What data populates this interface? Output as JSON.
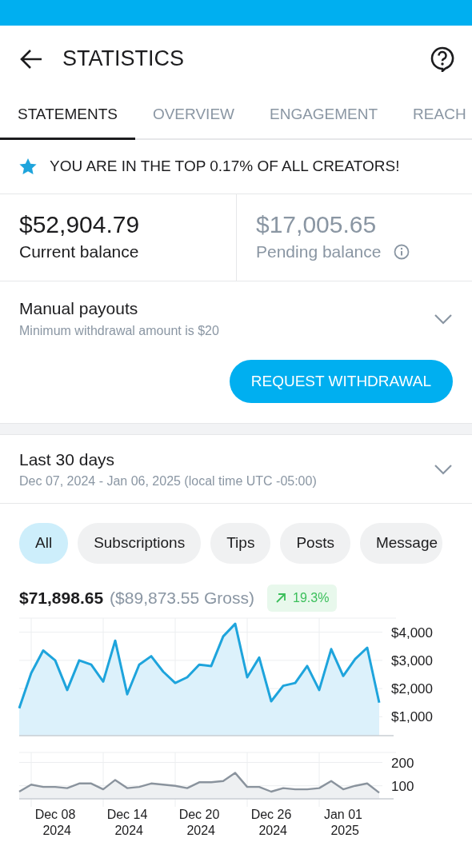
{
  "header": {
    "title": "STATISTICS"
  },
  "tabs": [
    {
      "label": "STATEMENTS",
      "selected": true
    },
    {
      "label": "OVERVIEW",
      "selected": false
    },
    {
      "label": "ENGAGEMENT",
      "selected": false
    },
    {
      "label": "REACH",
      "selected": false
    }
  ],
  "banner": {
    "text": "YOU ARE IN THE TOP 0.17% OF ALL CREATORS!"
  },
  "balances": [
    {
      "kind": "current",
      "amount": "$52,904.79",
      "label": "Current balance"
    },
    {
      "kind": "pending",
      "amount": "$17,005.65",
      "label": "Pending balance"
    }
  ],
  "payouts": {
    "title": "Manual payouts",
    "note": "Minimum withdrawal amount is $20",
    "expanded": false,
    "button": "REQUEST WITHDRAWAL"
  },
  "period": {
    "title": "Last 30 days",
    "range": "Dec 07, 2024 - Jan 06, 2025 (local time UTC -05:00)",
    "expanded": false
  },
  "filters": [
    {
      "label": "All",
      "selected": true
    },
    {
      "label": "Subscriptions",
      "selected": false
    },
    {
      "label": "Tips",
      "selected": false
    },
    {
      "label": "Posts",
      "selected": false
    },
    {
      "label": "Message",
      "selected": false
    }
  ],
  "summary": {
    "net": "$71,898.65",
    "gross": "($89,873.55 Gross)",
    "change": "19.3%",
    "rising": true
  },
  "earnings_chart": {
    "chart_data": {
      "type": "area",
      "grid": true,
      "ylim": [
        330,
        4500
      ],
      "yticks": [
        {
          "value": 1000,
          "label": "$1,000"
        },
        {
          "value": 2000,
          "label": "$2,000"
        },
        {
          "value": 3000,
          "label": "$3,000"
        },
        {
          "value": 4000,
          "label": "$4,000"
        }
      ],
      "series": [
        {
          "color": "#1ea4dc",
          "values": [
            1300,
            2550,
            3350,
            3000,
            1950,
            3000,
            2850,
            2250,
            3700,
            1800,
            2850,
            3150,
            2600,
            2200,
            2400,
            2850,
            2800,
            3850,
            4300,
            2400,
            3100,
            1550,
            2100,
            2200,
            2800,
            1950,
            3400,
            2450,
            3050,
            3450,
            1500
          ]
        }
      ]
    }
  },
  "count_chart": {
    "chart_data": {
      "type": "area",
      "grid": true,
      "ylim": [
        44,
        243
      ],
      "yticks": [
        100,
        200
      ],
      "categories": [
        null,
        null,
        null,
        "Dec 08 2024",
        null,
        null,
        null,
        null,
        null,
        "Dec 14 2024",
        null,
        null,
        null,
        null,
        null,
        "Dec 20 2024",
        null,
        null,
        null,
        null,
        null,
        "Dec 26 2024",
        null,
        null,
        null,
        null,
        null,
        "Jan 01 2025",
        null,
        null,
        null
      ],
      "series": [
        {
          "color": "#8a939d",
          "values": [
            75,
            105,
            95,
            95,
            90,
            110,
            110,
            85,
            125,
            90,
            95,
            110,
            105,
            100,
            90,
            115,
            115,
            120,
            155,
            95,
            95,
            75,
            90,
            85,
            85,
            90,
            120,
            85,
            100,
            110,
            70
          ]
        }
      ]
    }
  }
}
